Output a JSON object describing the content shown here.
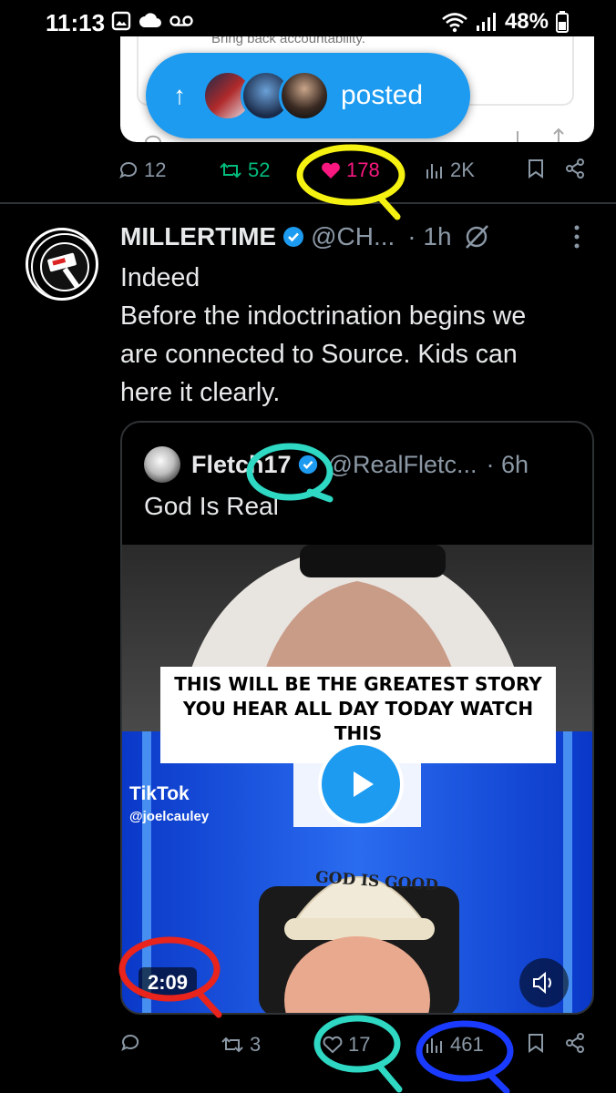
{
  "status_bar": {
    "time": "11:13",
    "battery": "48%"
  },
  "top_card": {
    "snippet": "Bring back accountability."
  },
  "posted_pill": {
    "label": "posted"
  },
  "top_actions": {
    "replies": "12",
    "reposts": "52",
    "likes": "178",
    "views": "2K"
  },
  "tweet": {
    "name": "MILLERTIME",
    "handle": "@CH...",
    "time": "· 1h",
    "lines": [
      "Indeed",
      "Before the indoctrination begins we",
      "are connected to Source. Kids can",
      "here it clearly."
    ]
  },
  "quote": {
    "name": "Fletch17",
    "handle": "@RealFletc...",
    "time": "· 6h",
    "text": "God Is Real",
    "video": {
      "caption_lines": [
        "THIS WILL BE THE GREATEST STORY",
        "YOU HEAR ALL DAY TODAY WATCH",
        "THIS"
      ],
      "watermark": "TikTok",
      "watermark_handle": "@joelcauley",
      "hat_text": "GOD IS GOOD",
      "duration": "2:09"
    }
  },
  "bottom_actions": {
    "reposts": "3",
    "likes": "17",
    "views": "461"
  },
  "colors": {
    "accent": "#1d9bf0",
    "like": "#f91880",
    "repost": "#00ba7c",
    "muted": "#8b98a5",
    "annot_yellow": "#f5f211",
    "annot_teal": "#2ed8c3",
    "annot_red": "#e8241c",
    "annot_blue": "#1a3bff"
  }
}
